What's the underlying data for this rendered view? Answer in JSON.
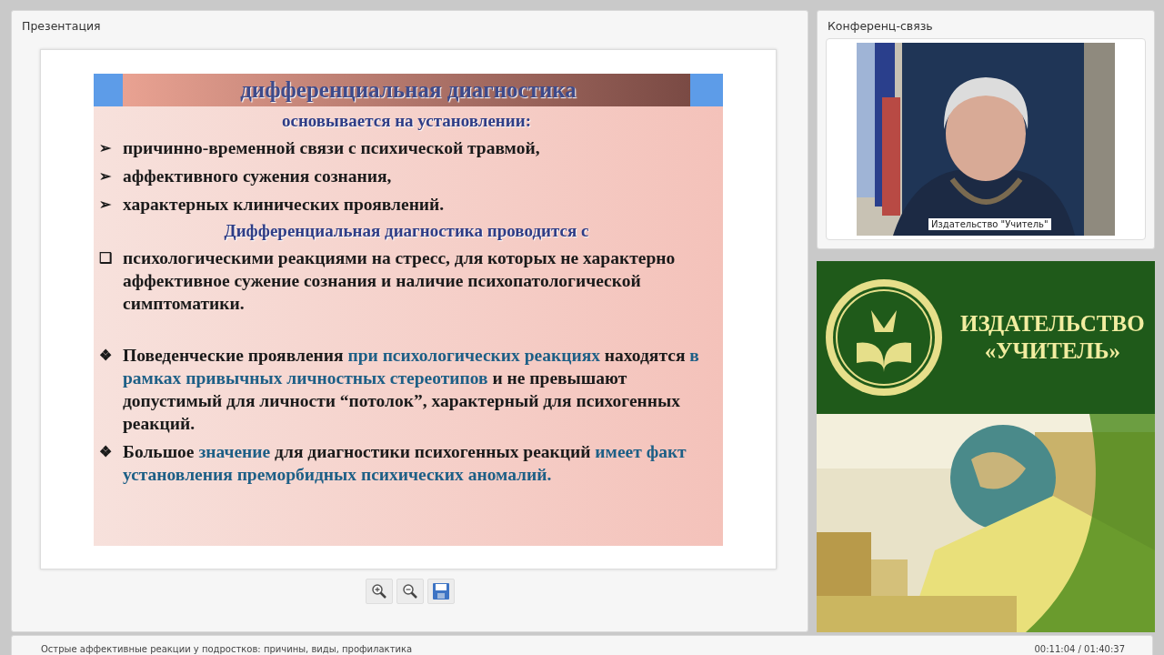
{
  "presentation": {
    "title": "Презентация",
    "slide": {
      "title": "дифференциальная диагностика",
      "items": [
        {
          "kind": "heading",
          "parts": [
            {
              "text": "основывается на установлении:",
              "emphasis": false
            }
          ]
        },
        {
          "kind": "bullet",
          "marker": "➢",
          "parts": [
            {
              "text": "причинно-временной связи с психической травмой,",
              "emphasis": false
            }
          ]
        },
        {
          "kind": "bullet",
          "marker": "➢",
          "parts": [
            {
              "text": "аффективного сужения сознания,",
              "emphasis": false
            }
          ]
        },
        {
          "kind": "bullet",
          "marker": "➢",
          "parts": [
            {
              "text": "характерных клинических проявлений.",
              "emphasis": false
            }
          ]
        },
        {
          "kind": "heading",
          "parts": [
            {
              "text": "Дифференциальная диагностика проводится с",
              "emphasis": false
            }
          ]
        },
        {
          "kind": "bullet",
          "marker": "❑",
          "parts": [
            {
              "text": "психологическими реакциями на стресс, для которых не характерно аффективное сужение сознания и наличие психопатологической симптоматики.",
              "emphasis": false
            }
          ]
        },
        {
          "kind": "gap"
        },
        {
          "kind": "bullet",
          "marker": "❖",
          "parts": [
            {
              "text": "Поведенческие проявления ",
              "emphasis": false
            },
            {
              "text": "при психологических реакциях",
              "emphasis": true
            },
            {
              "text": " находятся ",
              "emphasis": false
            },
            {
              "text": "в рамках привычных личностных стереотипов",
              "emphasis": true
            },
            {
              "text": " и не превышают допустимый для личности “потолок”, характерный для психогенных реакций.",
              "emphasis": false
            }
          ]
        },
        {
          "kind": "bullet",
          "marker": "❖",
          "parts": [
            {
              "text": " Большое ",
              "emphasis": false
            },
            {
              "text": "значение",
              "emphasis": true
            },
            {
              "text": " для диагностики психогенных реакций ",
              "emphasis": false
            },
            {
              "text": "имеет факт установления преморбидных психических аномалий.",
              "emphasis": true
            }
          ]
        }
      ]
    },
    "toolbar": [
      {
        "kind": "zoom-in"
      },
      {
        "kind": "zoom-out"
      },
      {
        "kind": "save"
      }
    ]
  },
  "conference": {
    "title": "Конференц-связь",
    "video": {
      "kind": "picture",
      "caption": "Издательство \"Учитель\""
    }
  },
  "banner": {
    "line_1": "ИЗДАТЕЛЬСТВО",
    "line_2": "«УЧИТЕЛЬ»"
  },
  "status_bar": {
    "title": "Острые аффективные реакции у подростков: причины, виды, профилактика",
    "time": "00:11:04 / 01:40:37"
  }
}
